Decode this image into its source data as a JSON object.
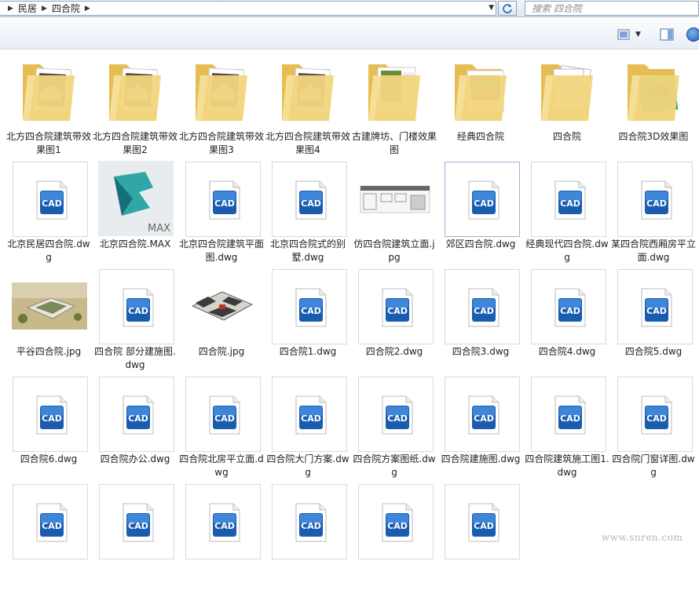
{
  "address": {
    "crumbs": [
      "民居",
      "四合院"
    ]
  },
  "search": {
    "placeholder": "搜索 四合院"
  },
  "colors": {
    "folder": "#f2d57e",
    "cad_blue": "#1a5db0"
  },
  "items": [
    {
      "label": "北方四合院建筑带效果图1",
      "type": "folder",
      "preview": "photo"
    },
    {
      "label": "北方四合院建筑带效果图2",
      "type": "folder",
      "preview": "photo"
    },
    {
      "label": "北方四合院建筑带效果图3",
      "type": "folder",
      "preview": "photo"
    },
    {
      "label": "北方四合院建筑带效果图4",
      "type": "folder",
      "preview": "photo"
    },
    {
      "label": "古建牌坊、门楼效果图",
      "type": "folder",
      "preview": "garden"
    },
    {
      "label": "经典四合院",
      "type": "folder",
      "preview": "photo2"
    },
    {
      "label": "四合院",
      "type": "folder",
      "preview": "docs"
    },
    {
      "label": "四合院3D效果图",
      "type": "folder",
      "preview": "green"
    },
    {
      "label": "北京民居四合院.dwg",
      "type": "dwg"
    },
    {
      "label": "北京四合院.MAX",
      "type": "max"
    },
    {
      "label": "北京四合院建筑平面图.dwg",
      "type": "dwg"
    },
    {
      "label": "北京四合院式的别墅.dwg",
      "type": "dwg"
    },
    {
      "label": "仿四合院建筑立面.jpg",
      "type": "jpg-elev"
    },
    {
      "label": "郊区四合院.dwg",
      "type": "dwg",
      "selected": true
    },
    {
      "label": "经典现代四合院.dwg",
      "type": "dwg"
    },
    {
      "label": "某四合院西厢房平立面.dwg",
      "type": "dwg"
    },
    {
      "label": "平谷四合院.jpg",
      "type": "jpg-aerial"
    },
    {
      "label": "四合院 部分建施图.dwg",
      "type": "dwg"
    },
    {
      "label": "四合院.jpg",
      "type": "jpg-house"
    },
    {
      "label": "四合院1.dwg",
      "type": "dwg"
    },
    {
      "label": "四合院2.dwg",
      "type": "dwg"
    },
    {
      "label": "四合院3.dwg",
      "type": "dwg"
    },
    {
      "label": "四合院4.dwg",
      "type": "dwg"
    },
    {
      "label": "四合院5.dwg",
      "type": "dwg"
    },
    {
      "label": "四合院6.dwg",
      "type": "dwg"
    },
    {
      "label": "四合院办公.dwg",
      "type": "dwg"
    },
    {
      "label": "四合院北房平立面.dwg",
      "type": "dwg"
    },
    {
      "label": "四合院大门方案.dwg",
      "type": "dwg"
    },
    {
      "label": "四合院方案图纸.dwg",
      "type": "dwg"
    },
    {
      "label": "四合院建施图.dwg",
      "type": "dwg"
    },
    {
      "label": "四合院建筑施工图1.dwg",
      "type": "dwg"
    },
    {
      "label": "四合院门窗详图.dwg",
      "type": "dwg"
    },
    {
      "label": "",
      "type": "dwg"
    },
    {
      "label": "",
      "type": "dwg"
    },
    {
      "label": "",
      "type": "dwg"
    },
    {
      "label": "",
      "type": "dwg"
    },
    {
      "label": "",
      "type": "dwg"
    },
    {
      "label": "",
      "type": "dwg"
    }
  ],
  "watermark": "www.snren.com"
}
